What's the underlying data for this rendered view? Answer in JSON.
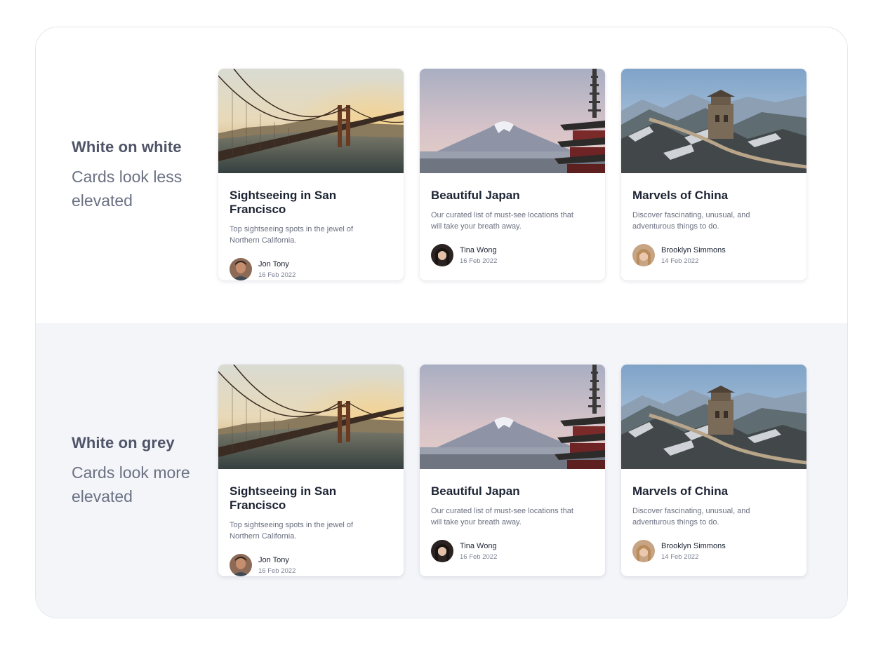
{
  "sections": [
    {
      "title": "White on white",
      "subtitle": "Cards look less elevated",
      "background": "#ffffff"
    },
    {
      "title": "White on grey",
      "subtitle": "Cards look more elevated",
      "background": "#f3f5f9"
    }
  ],
  "cards": [
    {
      "title": "Sightseeing in San Francisco",
      "description": "Top sightseeing spots in the jewel of Northern California.",
      "author": "Jon Tony",
      "date": "16 Feb 2022",
      "image": "golden-gate-bridge-photo",
      "avatar": "man-portrait"
    },
    {
      "title": "Beautiful Japan",
      "description": "Our curated list of must-see locations that will take your breath away.",
      "author": "Tina Wong",
      "date": "16 Feb 2022",
      "image": "mount-fuji-pagoda-photo",
      "avatar": "woman-portrait"
    },
    {
      "title": "Marvels of China",
      "description": "Discover fascinating, unusual, and adventurous things to do.",
      "author": "Brooklyn Simmons",
      "date": "14 Feb 2022",
      "image": "great-wall-photo",
      "avatar": "woman-blonde-portrait"
    }
  ]
}
